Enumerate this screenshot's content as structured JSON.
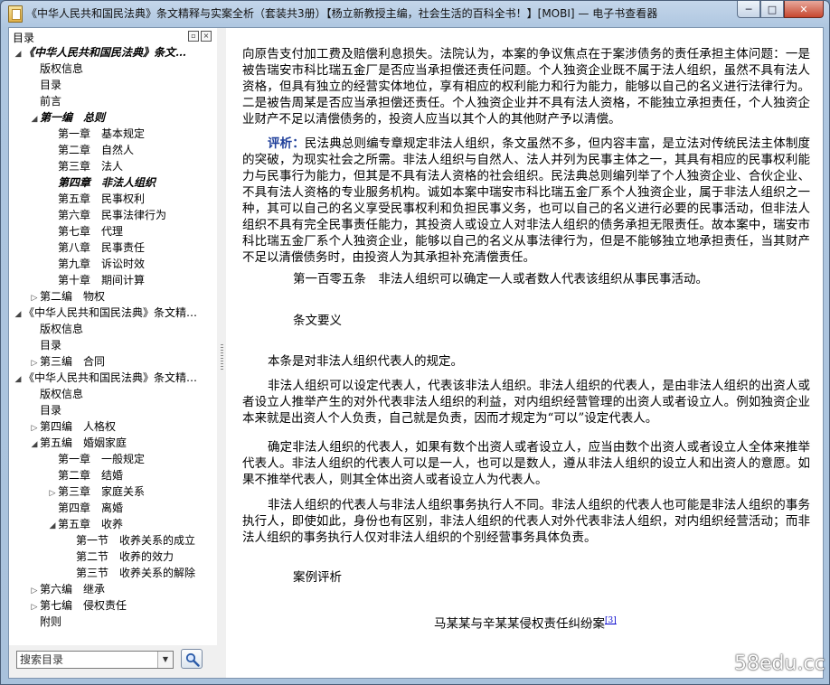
{
  "window": {
    "title": "《中华人民共和国民法典》条文精释与实案全析（套装共3册）【杨立新教授主编，社会生活的百科全书！】[MOBI] — 电子书查看器",
    "controls": {
      "minimize": "─",
      "maximize": "□",
      "close": "✕"
    }
  },
  "sidebar": {
    "header": "目录",
    "tree": [
      {
        "label": "《中华人民共和国民法典》条文…",
        "arrow": "▲",
        "indent": 0,
        "bold": true
      },
      {
        "label": "版权信息",
        "arrow": "",
        "indent": 1
      },
      {
        "label": "目录",
        "arrow": "",
        "indent": 1
      },
      {
        "label": "前言",
        "arrow": "",
        "indent": 1
      },
      {
        "label": "第一编　总则",
        "arrow": "▲",
        "indent": 1,
        "bold": true
      },
      {
        "label": "第一章　基本规定",
        "arrow": "",
        "indent": 2
      },
      {
        "label": "第二章　自然人",
        "arrow": "",
        "indent": 2
      },
      {
        "label": "第三章　法人",
        "arrow": "",
        "indent": 2
      },
      {
        "label": "第四章　非法人组织",
        "arrow": "",
        "indent": 2,
        "bold": true
      },
      {
        "label": "第五章　民事权利",
        "arrow": "",
        "indent": 2
      },
      {
        "label": "第六章　民事法律行为",
        "arrow": "",
        "indent": 2
      },
      {
        "label": "第七章　代理",
        "arrow": "",
        "indent": 2
      },
      {
        "label": "第八章　民事责任",
        "arrow": "",
        "indent": 2
      },
      {
        "label": "第九章　诉讼时效",
        "arrow": "",
        "indent": 2
      },
      {
        "label": "第十章　期间计算",
        "arrow": "",
        "indent": 2
      },
      {
        "label": "第二编　物权",
        "arrow": "▶",
        "indent": 1
      },
      {
        "label": "《中华人民共和国民法典》条文精…",
        "arrow": "▲",
        "indent": 0
      },
      {
        "label": "版权信息",
        "arrow": "",
        "indent": 1
      },
      {
        "label": "目录",
        "arrow": "",
        "indent": 1
      },
      {
        "label": "第三编　合同",
        "arrow": "▶",
        "indent": 1
      },
      {
        "label": "《中华人民共和国民法典》条文精…",
        "arrow": "▲",
        "indent": 0
      },
      {
        "label": "版权信息",
        "arrow": "",
        "indent": 1
      },
      {
        "label": "目录",
        "arrow": "",
        "indent": 1
      },
      {
        "label": "第四编　人格权",
        "arrow": "▶",
        "indent": 1
      },
      {
        "label": "第五编　婚姻家庭",
        "arrow": "▲",
        "indent": 1
      },
      {
        "label": "第一章　一般规定",
        "arrow": "",
        "indent": 2
      },
      {
        "label": "第二章　结婚",
        "arrow": "",
        "indent": 2
      },
      {
        "label": "第三章　家庭关系",
        "arrow": "▶",
        "indent": 2
      },
      {
        "label": "第四章　离婚",
        "arrow": "",
        "indent": 2
      },
      {
        "label": "第五章　收养",
        "arrow": "▲",
        "indent": 2
      },
      {
        "label": "第一节　收养关系的成立",
        "arrow": "",
        "indent": 3
      },
      {
        "label": "第二节　收养的效力",
        "arrow": "",
        "indent": 3
      },
      {
        "label": "第三节　收养关系的解除",
        "arrow": "",
        "indent": 3
      },
      {
        "label": "第六编　继承",
        "arrow": "▶",
        "indent": 1
      },
      {
        "label": "第七编　侵权责任",
        "arrow": "▶",
        "indent": 1
      },
      {
        "label": "附则",
        "arrow": "",
        "indent": 1
      }
    ],
    "search_placeholder": "搜索目录"
  },
  "content": {
    "p1": "向原告支付加工费及赔偿利息损失。法院认为，本案的争议焦点在于案涉债务的责任承担主体问题：一是被告瑞安市科比瑞五金厂是否应当承担偿还责任问题。个人独资企业既不属于法人组织，虽然不具有法人资格，但具有独立的经营实体地位，享有相应的权利能力和行为能力，能够以自己的名义进行法律行为。二是被告周某是否应当承担偿还责任。个人独资企业并不具有法人资格，不能独立承担责任，个人独资企业财产不足以清偿债务的，投资人应当以其个人的其他财产予以清偿。",
    "p2_label": "评析：",
    "p2": "民法典总则编专章规定非法人组织，条文虽然不多，但内容丰富，是立法对传统民法主体制度的突破，为现实社会之所需。非法人组织与自然人、法人并列为民事主体之一，其具有相应的民事权利能力与民事行为能力，但其是不具有法人资格的社会组织。民法典总则编列举了个人独资企业、合伙企业、不具有法人资格的专业服务机构。诚如本案中瑞安市科比瑞五金厂系个人独资企业，属于非法人组织之一种，其可以自己的名义享受民事权利和负担民事义务，也可以自己的名义进行必要的民事活动，但非法人组织不具有完全民事责任能力，其投资人或设立人对非法人组织的债务承担无限责任。故本案中，瑞安市科比瑞五金厂系个人独资企业，能够以自己的名义从事法律行为，但是不能够独立地承担责任，当其财产不足以清偿债务时，由投资人为其承担补充清偿责任。",
    "article": "第一百零五条　非法人组织可以确定一人或者数人代表该组织从事民事活动。",
    "essentials_title": "条文要义",
    "p3": "本条是对非法人组织代表人的规定。",
    "p4": "非法人组织可以设定代表人，代表该非法人组织。非法人组织的代表人，是由非法人组织的出资人或者设立人推举产生的对外代表非法人组织的利益，对内组织经营管理的出资人或者设立人。例如独资企业本来就是出资人个人负责，自己就是负责，因而才规定为“可以”设定代表人。",
    "p5": "确定非法人组织的代表人，如果有数个出资人或者设立人，应当由数个出资人或者设立人全体来推举代表人。非法人组织的代表人可以是一人，也可以是数人，遵从非法人组织的设立人和出资人的意愿。如果不推举代表人，则其全体出资人或者设立人为代表人。",
    "p6": "非法人组织的代表人与非法人组织事务执行人不同。非法人组织的代表人也可能是非法人组织的事务执行人，即使如此，身份也有区别，非法人组织的代表人对外代表非法人组织，对内组织经营活动；而非法人组织的事务执行人仅对非法人组织的个别经营事务具体负责。",
    "case_title": "案例评析",
    "case_name": "马某某与辛某某侵权责任纠纷案",
    "footnote": "[3]"
  },
  "watermark": "58edu.cc"
}
